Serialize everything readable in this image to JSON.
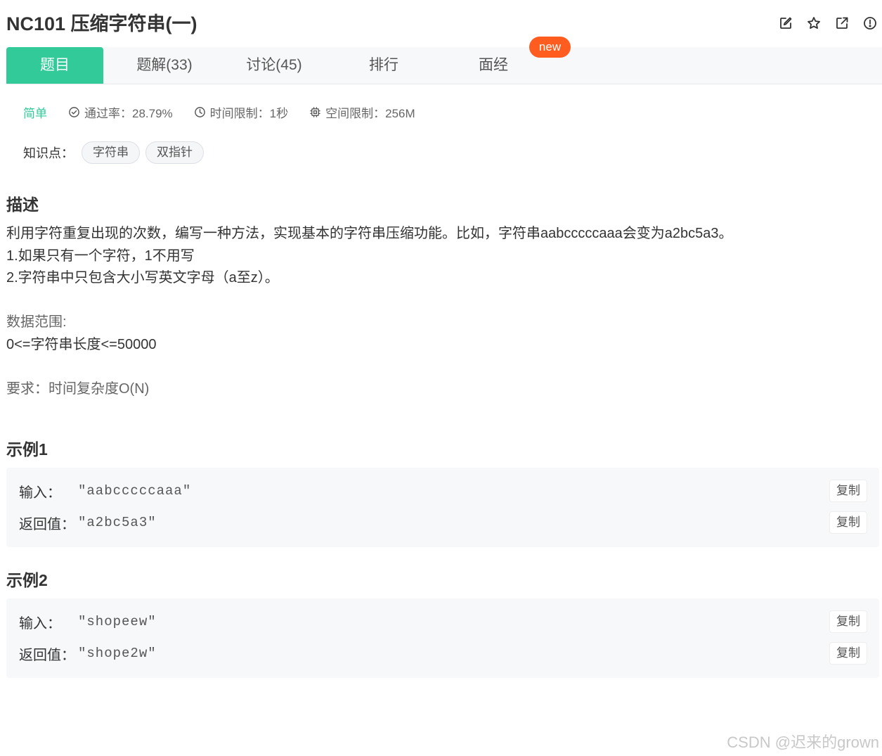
{
  "problem": {
    "title": "NC101  压缩字符串(一)"
  },
  "header_icons": [
    "edit-icon",
    "star-icon",
    "external-link-icon",
    "report-icon"
  ],
  "tabs": [
    {
      "label": "题目"
    },
    {
      "label": "题解(33)"
    },
    {
      "label": "讨论(45)"
    },
    {
      "label": "排行"
    },
    {
      "label": "面经"
    }
  ],
  "new_badge": "new",
  "meta": {
    "difficulty": "简单",
    "pass_rate": "通过率：28.79%",
    "time_limit": "时间限制：1秒",
    "space_limit": "空间限制：256M"
  },
  "knowledge": {
    "label": "知识点：",
    "tags": [
      "字符串",
      "双指针"
    ]
  },
  "description": {
    "heading": "描述",
    "lines": [
      "利用字符重复出现的次数，编写一种方法，实现基本的字符串压缩功能。比如，字符串aabcccccaaa会变为a2bc5a3。",
      "1.如果只有一个字符，1不用写",
      "2.字符串中只包含大小写英文字母（a至z）。"
    ],
    "range_label": "数据范围:",
    "range_value": "0<=字符串长度<=50000",
    "requirement": "要求：时间复杂度O(N)"
  },
  "examples": [
    {
      "heading": "示例1",
      "input_label": "输入：",
      "input_value": "\"aabcccccaaa\"",
      "output_label": "返回值：",
      "output_value": "\"a2bc5a3\""
    },
    {
      "heading": "示例2",
      "input_label": "输入：",
      "input_value": "\"shopeew\"",
      "output_label": "返回值：",
      "output_value": "\"shope2w\""
    }
  ],
  "copy_label": "复制",
  "watermark": "CSDN @迟来的grown",
  "colors": {
    "accent": "#32ca99",
    "badge": "#ff5c1f"
  }
}
